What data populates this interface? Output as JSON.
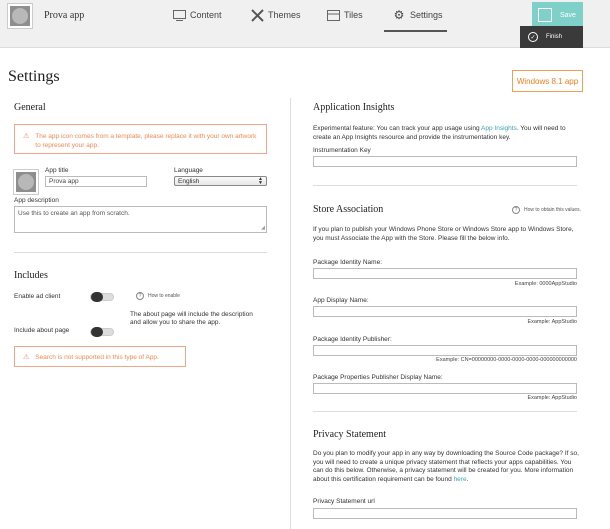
{
  "app": {
    "name": "Prova app"
  },
  "nav": {
    "tabs": [
      {
        "label": "Content",
        "icon": "monitor-icon"
      },
      {
        "label": "Themes",
        "icon": "tools-icon"
      },
      {
        "label": "Tiles",
        "icon": "tiles-icon"
      },
      {
        "label": "Settings",
        "icon": "gear-icon",
        "active": true
      }
    ],
    "save_label": "Save",
    "finish_label": "Finish"
  },
  "page": {
    "title": "Settings",
    "platform_button": "Windows 8.1 app"
  },
  "general": {
    "heading": "General",
    "warning": "The app icon comes from a template, please replace it with your own artwork to represent your app.",
    "app_title_label": "App title",
    "app_title_value": "Prova app",
    "language_label": "Language",
    "language_value": "English",
    "description_label": "App description",
    "description_value": "Use this to create an app from scratch."
  },
  "includes": {
    "heading": "Includes",
    "ad_client_label": "Enable ad client",
    "ad_client_on": false,
    "how_to_enable": "How to enable",
    "about_help": "The about page will include the description and allow you to share the app.",
    "about_page_label": "Include about page",
    "about_page_on": false,
    "search_warning": "Search is not supported in this type of App."
  },
  "insights": {
    "heading": "Application Insights",
    "text_before_link": "Experimental feature: You can track your app usage using ",
    "link": "App Insights",
    "text_after_link": ". You will need to create an App Insights resource and provide the instrumentation key.",
    "key_label": "Instrumentation Key",
    "key_value": ""
  },
  "store": {
    "heading": "Store Association",
    "how_to_obtain": "How to obtain this values.",
    "description": "If you plan to publish your Windows Phone Store or Windows Store app to Windows Store, you must Associate the App with the Store. Please fill the below info.",
    "fields": [
      {
        "label": "Package Identity Name:",
        "value": "",
        "example": "Example: 0000AppStudio"
      },
      {
        "label": "App Display Name:",
        "value": "",
        "example": "Example: AppStudio"
      },
      {
        "label": "Package Identity Publisher:",
        "value": "",
        "example": "Example: CN=00000000-0000-0000-0000-000000000000"
      },
      {
        "label": "Package Properties Publisher Display Name:",
        "value": "",
        "example": "Example: AppStudio"
      }
    ]
  },
  "privacy": {
    "heading": "Privacy Statement",
    "text": "Do you plan to modify your app in any way by downloading the Source Code package? If so, you will need to create a unique privacy statement that reflects your apps capabilities. You can do this below. Otherwise, a privacy statement will be created for you. More information about this certification requirement can be found ",
    "link": "here",
    "text_end": ".",
    "url_label": "Privacy Statement url",
    "url_value": ""
  },
  "colors": {
    "accent_teal": "#7fd0c8",
    "warning_orange": "#f08a55",
    "link": "#3aa3b5",
    "finish_dark": "#3a3a3a"
  }
}
